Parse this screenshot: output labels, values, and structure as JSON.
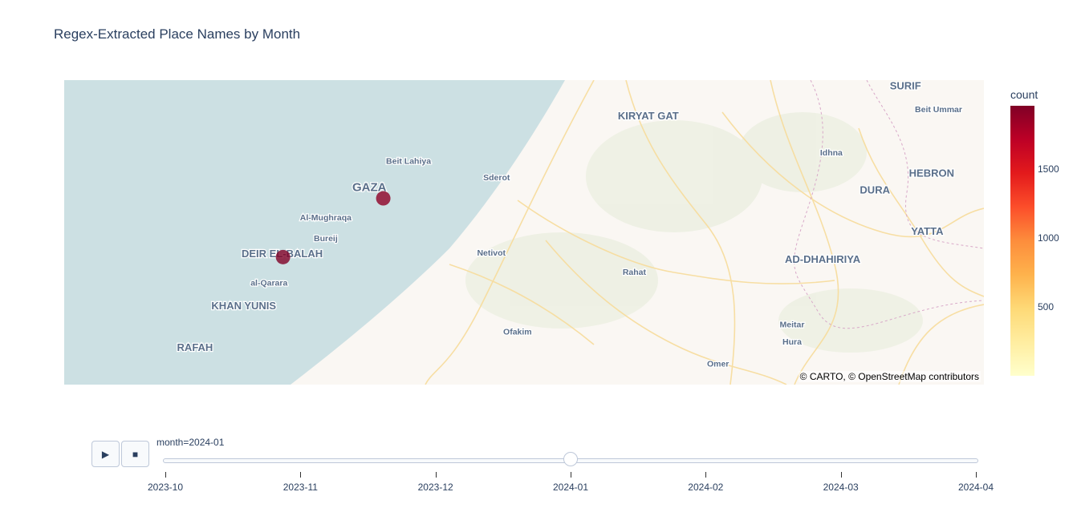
{
  "chart_data": {
    "type": "scatter",
    "title": "Regex-Extracted Place Names by Month",
    "colorbar": {
      "title": "count",
      "colorscale": [
        "#ffffcc",
        "#ffeda0",
        "#fed976",
        "#feb24c",
        "#fd8d3c",
        "#fc4e2a",
        "#e31a1c",
        "#bd0026",
        "#800026"
      ],
      "range": [
        1,
        1960
      ],
      "ticks": [
        500,
        1000,
        1500
      ]
    },
    "points": [
      {
        "place": "Gaza",
        "lat": 31.5,
        "lon": 34.466,
        "count": 1900
      },
      {
        "place": "Deir el-Balah",
        "lat": 31.418,
        "lon": 34.351,
        "count": 1960
      }
    ],
    "map_labels": [
      {
        "text": "SURIF",
        "lat": 31.652,
        "lon": 35.065
      },
      {
        "text": "Beit Ummar",
        "lat": 31.62,
        "lon": 35.103
      },
      {
        "text": "KIRYAT GAT",
        "lat": 31.61,
        "lon": 34.77
      },
      {
        "text": "Idhna",
        "lat": 31.56,
        "lon": 34.98
      },
      {
        "text": "Beit Lahiya",
        "lat": 31.548,
        "lon": 34.495
      },
      {
        "text": "Sderot",
        "lat": 31.525,
        "lon": 34.596
      },
      {
        "text": "HEBRON",
        "lat": 31.53,
        "lon": 35.095
      },
      {
        "text": "DURA",
        "lat": 31.507,
        "lon": 35.03
      },
      {
        "text": "GAZA",
        "lat": 31.51,
        "lon": 34.45
      },
      {
        "text": "Al-Mughraqa",
        "lat": 31.469,
        "lon": 34.4
      },
      {
        "text": "Bureij",
        "lat": 31.44,
        "lon": 34.4
      },
      {
        "text": "YATTA",
        "lat": 31.449,
        "lon": 35.09
      },
      {
        "text": "DEIR EL-BALAH",
        "lat": 31.418,
        "lon": 34.35
      },
      {
        "text": "Netivot",
        "lat": 31.42,
        "lon": 34.59
      },
      {
        "text": "AD-DHAHIRIYA",
        "lat": 31.41,
        "lon": 34.97
      },
      {
        "text": "Rahat",
        "lat": 31.393,
        "lon": 34.754
      },
      {
        "text": "al-Qarara",
        "lat": 31.378,
        "lon": 34.335
      },
      {
        "text": "KHAN YUNIS",
        "lat": 31.345,
        "lon": 34.306
      },
      {
        "text": "Meitar",
        "lat": 31.32,
        "lon": 34.935
      },
      {
        "text": "Ofakim",
        "lat": 31.31,
        "lon": 34.62
      },
      {
        "text": "Hura",
        "lat": 31.296,
        "lon": 34.935
      },
      {
        "text": "RAFAH",
        "lat": 31.287,
        "lon": 34.25
      },
      {
        "text": "Omer",
        "lat": 31.265,
        "lon": 34.85
      }
    ]
  },
  "attribution": "© CARTO, © OpenStreetMap contributors",
  "animation": {
    "current_label": "month=2024-01",
    "current_index": 3,
    "steps": [
      "2023-10",
      "2023-11",
      "2023-12",
      "2024-01",
      "2024-02",
      "2024-03",
      "2024-04"
    ],
    "play_icon": "play-icon",
    "stop_icon": "stop-icon"
  }
}
